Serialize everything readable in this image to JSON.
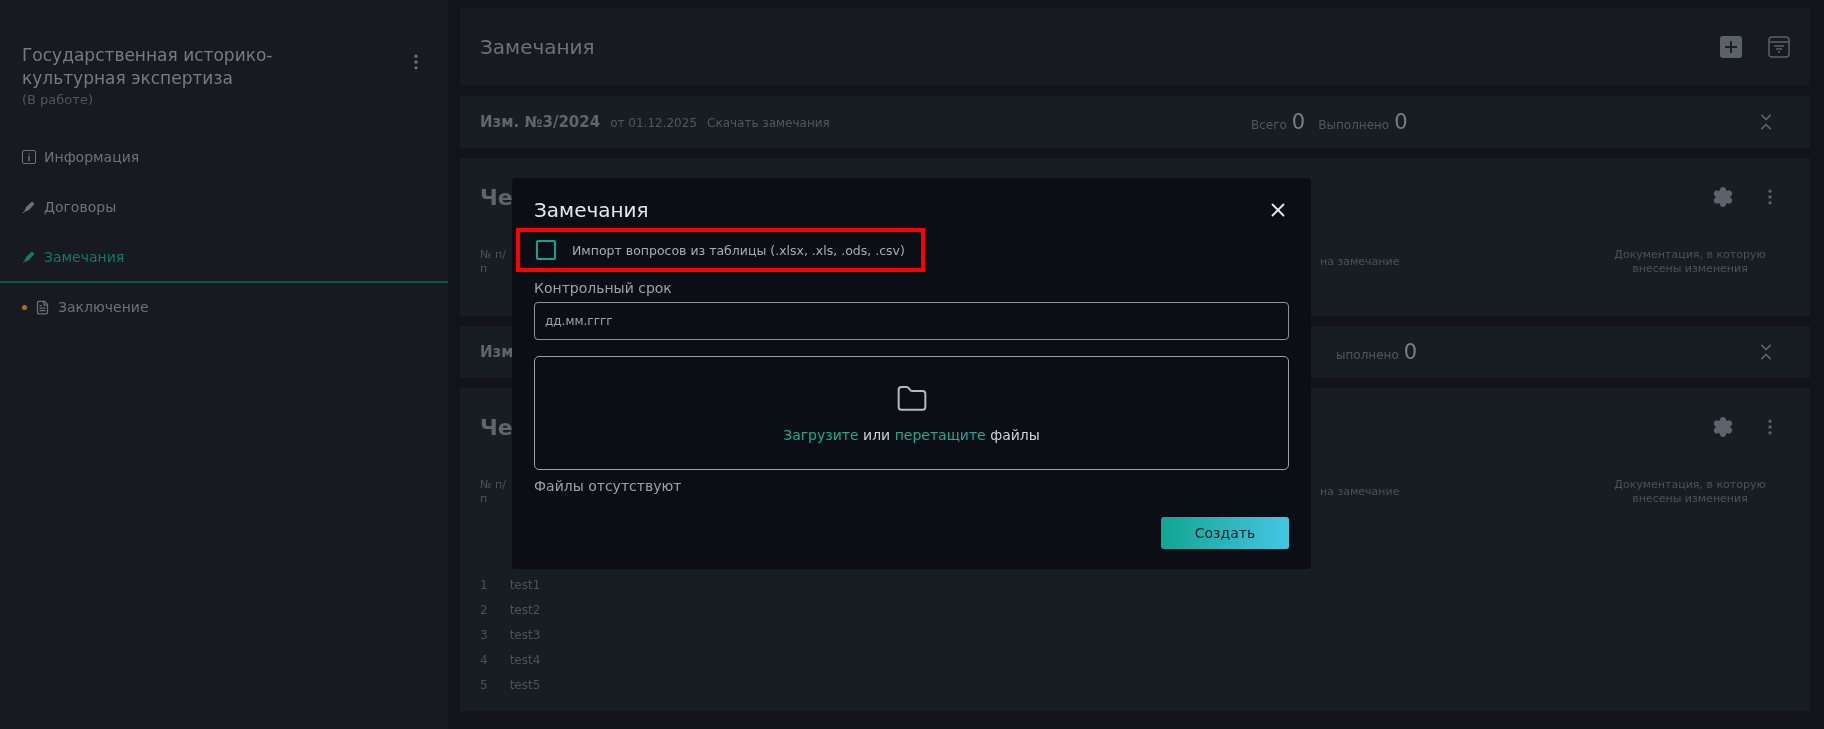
{
  "sidebar": {
    "title": "Государственная историко-культурная экспертиза",
    "status": "(В работе)",
    "items": [
      {
        "label": "Информация",
        "kind": "info",
        "selected": false,
        "marker": false
      },
      {
        "label": "Договоры",
        "kind": "pen",
        "selected": false,
        "marker": false
      },
      {
        "label": "Замечания",
        "kind": "pen",
        "selected": true,
        "marker": false
      },
      {
        "label": "Заключение",
        "kind": "document",
        "selected": false,
        "marker": true
      }
    ]
  },
  "header": {
    "title": "Замечания"
  },
  "sections": [
    {
      "kind": "revision",
      "title": "Изм. №3/2024",
      "date": "от 01.12.2025",
      "link": "Скачать замечания",
      "total_label": "Всего",
      "total": "0",
      "done_label": "Выполнено",
      "done": "0"
    },
    {
      "kind": "card",
      "title": "Че",
      "columns": [
        "№ п/п",
        "на замечание",
        "Документация, в которую внесены изменения"
      ]
    },
    {
      "kind": "revision",
      "title": "Изм",
      "done_label": "ыполнено",
      "done": "0"
    },
    {
      "kind": "card",
      "title": "Че",
      "columns": [
        "№ п/п",
        "на замечание",
        "Документация, в которую внесены изменения"
      ],
      "rows": [
        {
          "number": "1",
          "text": "test1"
        },
        {
          "number": "2",
          "text": "test2"
        },
        {
          "number": "3",
          "text": "test3"
        },
        {
          "number": "4",
          "text": "test4"
        },
        {
          "number": "5",
          "text": "test5"
        }
      ]
    }
  ],
  "modal": {
    "title": "Замечания",
    "import_checkbox": {
      "label": "Импорт вопросов из таблицы (.xlsx, .xls, .ods, .csv)",
      "checked": false,
      "highlighted": true
    },
    "deadline": {
      "label": "Контрольный срок",
      "placeholder": "дд.мм.гггг"
    },
    "dropzone": {
      "upload_link": "Загрузите",
      "joiner": "или",
      "drag_link": "перетащите",
      "tail": "файлы"
    },
    "files_status": "Файлы отсутствуют",
    "submit": "Создать"
  }
}
